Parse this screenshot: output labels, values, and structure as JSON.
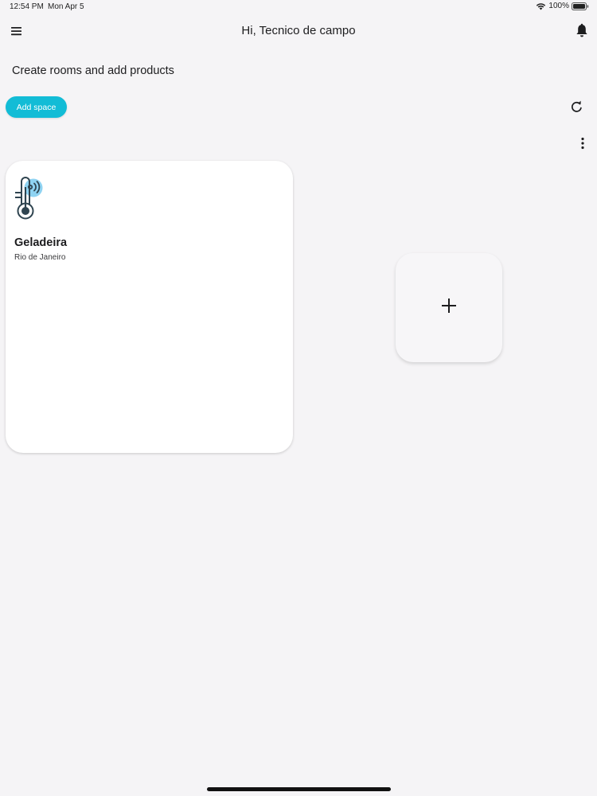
{
  "status_bar": {
    "time": "12:54 PM",
    "date": "Mon Apr 5",
    "battery": "100%",
    "icons": [
      "wifi-icon",
      "battery-icon"
    ]
  },
  "header": {
    "title": "Hi, Tecnico de campo",
    "icons": [
      "menu-icon",
      "bell-icon"
    ]
  },
  "main": {
    "subtitle": "Create rooms and add products",
    "add_space_label": "Add space",
    "toolbar_icons": [
      "refresh-icon",
      "more-vertical-icon"
    ],
    "accent_color": "#12bcd6",
    "spaces": [
      {
        "name": "Geladeira",
        "location": "Rio de Janeiro",
        "icon": "thermometer-wireless-icon"
      }
    ],
    "add_card_icon": "plus-icon"
  }
}
